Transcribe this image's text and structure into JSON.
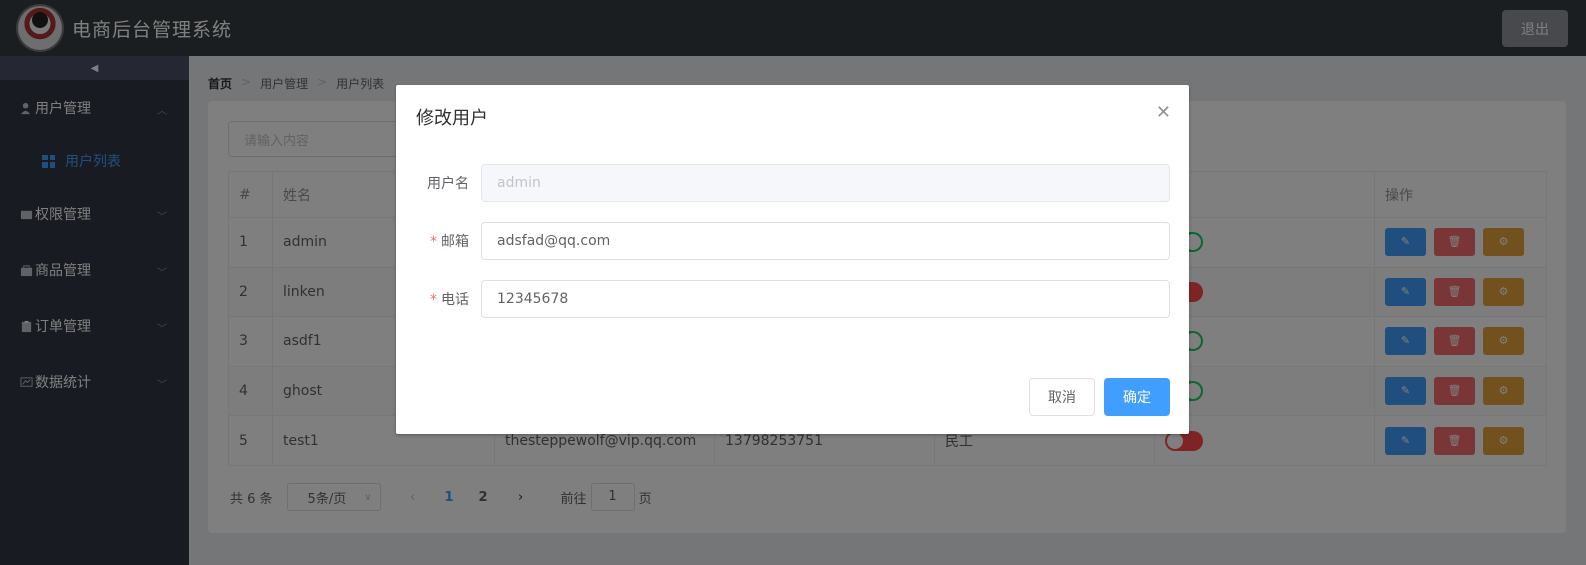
{
  "header": {
    "title": "电商后台管理系统",
    "logout_label": "退出"
  },
  "sidebar": {
    "collapse_icon": "caret-left-icon",
    "menus": [
      {
        "label": "用户管理",
        "icon": "user-icon",
        "expanded": true,
        "children": [
          {
            "label": "用户列表",
            "icon": "grid-icon"
          }
        ]
      },
      {
        "label": "权限管理",
        "icon": "box-icon"
      },
      {
        "label": "商品管理",
        "icon": "bag-icon"
      },
      {
        "label": "订单管理",
        "icon": "clipboard-icon"
      },
      {
        "label": "数据统计",
        "icon": "chart-icon"
      }
    ]
  },
  "breadcrumb": {
    "home": "首页",
    "level1": "用户管理",
    "level2": "用户列表"
  },
  "search": {
    "placeholder": "请输入内容"
  },
  "table": {
    "headers": {
      "index": "#",
      "name": "姓名",
      "ops": "操作"
    },
    "rows": [
      {
        "index": "1",
        "name": "admin",
        "email": "",
        "phone": "",
        "role": "",
        "state": "on"
      },
      {
        "index": "2",
        "name": "linken",
        "email": "",
        "phone": "",
        "role": "",
        "state": "off"
      },
      {
        "index": "3",
        "name": "asdf1",
        "email": "",
        "phone": "",
        "role": "",
        "state": "on"
      },
      {
        "index": "4",
        "name": "ghost",
        "email": "",
        "phone": "",
        "role": "",
        "state": "on"
      },
      {
        "index": "5",
        "name": "test1",
        "email": "thesteppewolf@vip.qq.com",
        "phone": "13798253751",
        "role": "民工",
        "state": "off"
      }
    ]
  },
  "pagination": {
    "total": "共 6 条",
    "page_size": "5条/页",
    "pages": [
      "1",
      "2"
    ],
    "current": "1",
    "goto_label": "前往",
    "goto_value": "1",
    "page_unit": "页"
  },
  "dialog": {
    "title": "修改用户",
    "fields": {
      "username": {
        "label": "用户名",
        "value": "admin"
      },
      "email": {
        "label": "邮箱",
        "value": "adsfad@qq.com"
      },
      "phone": {
        "label": "电话",
        "value": "12345678"
      }
    },
    "cancel_label": "取消",
    "confirm_label": "确定"
  },
  "colors": {
    "primary": "#409eff",
    "danger": "#f56c6c",
    "warning": "#e6a23c",
    "success": "#13ce66",
    "header_bg": "#373d41",
    "sidebar_bg": "#333744"
  }
}
